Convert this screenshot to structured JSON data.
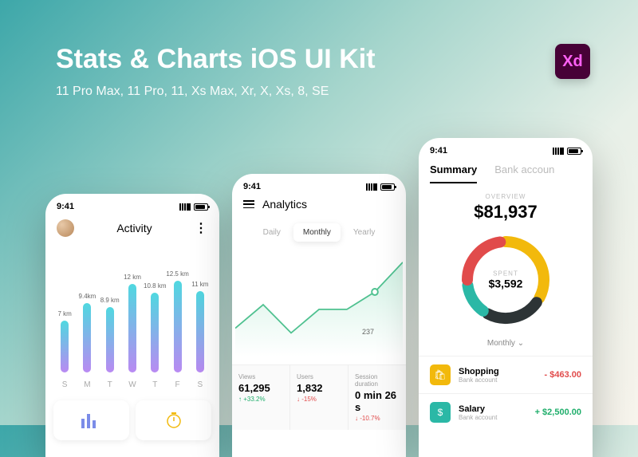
{
  "hero": {
    "title": "Stats & Charts iOS UI Kit",
    "subtitle": "11 Pro Max, 11 Pro, 11, Xs Max, Xr, X, Xs, 8, SE"
  },
  "xd_badge": "Xd",
  "status_time": "9:41",
  "phone1": {
    "title": "Activity",
    "days": [
      "S",
      "M",
      "T",
      "W",
      "T",
      "F",
      "S"
    ]
  },
  "phone2": {
    "title": "Analytics",
    "tabs": {
      "daily": "Daily",
      "monthly": "Monthly",
      "yearly": "Yearly"
    },
    "marker": "237",
    "metrics": {
      "views": {
        "label": "Views",
        "value": "61,295",
        "delta": "+33.2%"
      },
      "users": {
        "label": "Users",
        "value": "1,832",
        "delta": "-15%"
      },
      "session": {
        "label": "Session duration",
        "value": "0 min 26 s",
        "delta": "-10.7%"
      }
    }
  },
  "phone3": {
    "tabs": {
      "summary": "Summary",
      "bank": "Bank accoun"
    },
    "overview_label": "OVERVIEW",
    "overview_amount": "$81,937",
    "spent_label": "SPENT",
    "spent_amount": "$3,592",
    "period": "Monthly",
    "tx1": {
      "title": "Shopping",
      "sub": "Bank account",
      "amount": "- $463.00"
    },
    "tx2": {
      "title": "Salary",
      "sub": "Bank account",
      "amount": "+ $2,500.00"
    }
  },
  "chart_data": [
    {
      "type": "bar",
      "title": "Activity",
      "categories": [
        "S",
        "M",
        "T",
        "W",
        "T",
        "F",
        "S"
      ],
      "labels_km": [
        "7 km",
        "9.4km",
        "8.9 km",
        "12 km",
        "10.8 km",
        "12.5 km",
        "11 km"
      ],
      "values": [
        7,
        9.4,
        8.9,
        12,
        10.8,
        12.5,
        11
      ],
      "ylabel": "km",
      "ylim": [
        0,
        13
      ]
    },
    {
      "type": "line",
      "title": "Analytics (Monthly)",
      "x": [
        1,
        2,
        3,
        4,
        5,
        6,
        7
      ],
      "values": [
        160,
        210,
        150,
        200,
        200,
        237,
        300
      ],
      "annotation": {
        "index": 5,
        "value": 237
      },
      "ylim": [
        100,
        320
      ]
    },
    {
      "type": "pie",
      "title": "Spending Overview",
      "series": [
        {
          "name": "Yellow",
          "value": 35,
          "color": "#f2b90c"
        },
        {
          "name": "Dark",
          "value": 25,
          "color": "#2d3436"
        },
        {
          "name": "Teal",
          "value": 15,
          "color": "#2bb8a6"
        },
        {
          "name": "Red",
          "value": 25,
          "color": "#e14b4b"
        }
      ],
      "center_label": "SPENT",
      "center_value": "$3,592",
      "total_label": "OVERVIEW",
      "total_value": "$81,937"
    }
  ]
}
